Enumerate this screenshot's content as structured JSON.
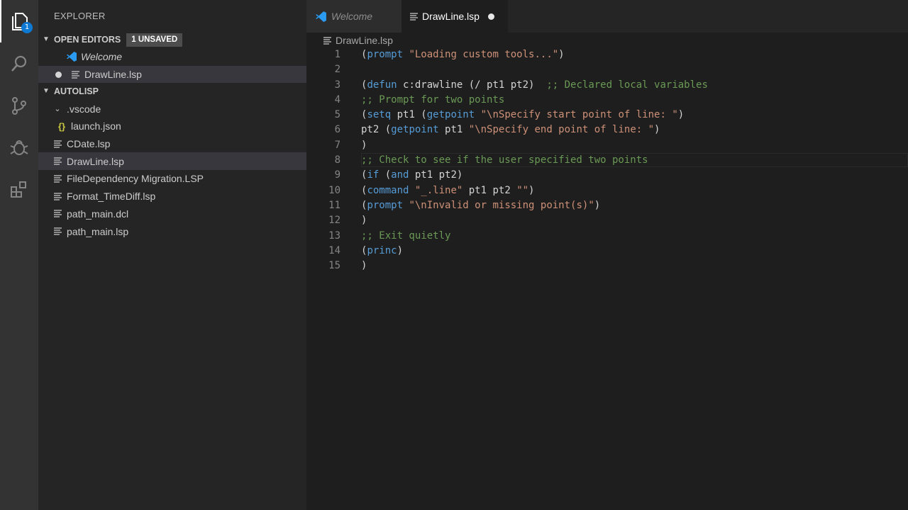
{
  "activity_bar": {
    "items": [
      {
        "name": "explorer",
        "icon": "files-icon",
        "badge": "1",
        "active": true
      },
      {
        "name": "search",
        "icon": "search-icon"
      },
      {
        "name": "scm",
        "icon": "source-control-icon"
      },
      {
        "name": "debug",
        "icon": "debug-icon"
      },
      {
        "name": "extensions",
        "icon": "extensions-icon"
      }
    ]
  },
  "sidebar": {
    "title": "EXPLORER",
    "open_editors": {
      "label": "OPEN EDITORS",
      "badge": "1 UNSAVED",
      "items": [
        {
          "label": "Welcome",
          "icon": "vscode-icon"
        },
        {
          "label": "DrawLine.lsp",
          "icon": "file-lines-icon",
          "modified": true
        }
      ]
    },
    "folder": {
      "label": "AUTOLISP",
      "items": [
        {
          "label": ".vscode",
          "icon": "chevron-down-icon",
          "indent": 1
        },
        {
          "label": "launch.json",
          "icon": "json-icon",
          "indent": 2
        },
        {
          "label": "CDate.lsp",
          "icon": "file-lines-icon",
          "indent": 1
        },
        {
          "label": "DrawLine.lsp",
          "icon": "file-lines-icon",
          "indent": 1,
          "selected": true
        },
        {
          "label": "FileDependency Migration.LSP",
          "icon": "file-lines-icon",
          "indent": 1
        },
        {
          "label": "Format_TimeDiff.lsp",
          "icon": "file-lines-icon",
          "indent": 1
        },
        {
          "label": "path_main.dcl",
          "icon": "file-lines-icon",
          "indent": 1
        },
        {
          "label": "path_main.lsp",
          "icon": "file-lines-icon",
          "indent": 1
        }
      ]
    }
  },
  "tabs": [
    {
      "label": "Welcome",
      "icon": "vscode-icon",
      "active": false
    },
    {
      "label": "DrawLine.lsp",
      "icon": "file-lines-icon",
      "active": true,
      "modified": true
    }
  ],
  "breadcrumb": "DrawLine.lsp",
  "editor": {
    "lines": [
      {
        "n": "1",
        "tokens": [
          [
            "d",
            "("
          ],
          [
            "k",
            "prompt"
          ],
          [
            "d",
            " "
          ],
          [
            "s",
            "\"Loading custom tools...\""
          ],
          [
            "d",
            ")"
          ]
        ]
      },
      {
        "n": "2",
        "tokens": []
      },
      {
        "n": "3",
        "tokens": [
          [
            "d",
            "("
          ],
          [
            "k",
            "defun"
          ],
          [
            "d",
            " c:drawline (/ pt1 pt2)  "
          ],
          [
            "c",
            ";; Declared local variables"
          ]
        ]
      },
      {
        "n": "4",
        "tokens": [
          [
            "c",
            ";; Prompt for two points"
          ]
        ]
      },
      {
        "n": "5",
        "tokens": [
          [
            "d",
            "("
          ],
          [
            "k",
            "setq"
          ],
          [
            "d",
            " pt1 ("
          ],
          [
            "k",
            "getpoint"
          ],
          [
            "d",
            " "
          ],
          [
            "s",
            "\"\\nSpecify start point of line: \""
          ],
          [
            "d",
            ")"
          ]
        ]
      },
      {
        "n": "6",
        "tokens": [
          [
            "d",
            "pt2 ("
          ],
          [
            "k",
            "getpoint"
          ],
          [
            "d",
            " pt1 "
          ],
          [
            "s",
            "\"\\nSpecify end point of line: \""
          ],
          [
            "d",
            ")"
          ]
        ]
      },
      {
        "n": "7",
        "tokens": [
          [
            "d",
            ")"
          ]
        ]
      },
      {
        "n": "8",
        "tokens": [
          [
            "c",
            ";; Check to see if the user specified two points"
          ]
        ],
        "current": true
      },
      {
        "n": "9",
        "tokens": [
          [
            "d",
            "("
          ],
          [
            "k",
            "if"
          ],
          [
            "d",
            " ("
          ],
          [
            "k",
            "and"
          ],
          [
            "d",
            " pt1 pt2)"
          ]
        ]
      },
      {
        "n": "10",
        "tokens": [
          [
            "d",
            "("
          ],
          [
            "k",
            "command"
          ],
          [
            "d",
            " "
          ],
          [
            "s",
            "\"_.line\""
          ],
          [
            "d",
            " pt1 pt2 "
          ],
          [
            "s",
            "\"\""
          ],
          [
            "d",
            ")"
          ]
        ]
      },
      {
        "n": "11",
        "tokens": [
          [
            "d",
            "("
          ],
          [
            "k",
            "prompt"
          ],
          [
            "d",
            " "
          ],
          [
            "s",
            "\"\\nInvalid or missing point(s)\""
          ],
          [
            "d",
            ")"
          ]
        ]
      },
      {
        "n": "12",
        "tokens": [
          [
            "d",
            ")"
          ]
        ]
      },
      {
        "n": "13",
        "tokens": [
          [
            "c",
            ";; Exit quietly"
          ]
        ]
      },
      {
        "n": "14",
        "tokens": [
          [
            "d",
            "("
          ],
          [
            "k",
            "princ"
          ],
          [
            "d",
            ")"
          ]
        ]
      },
      {
        "n": "15",
        "tokens": [
          [
            "d",
            ")"
          ]
        ]
      }
    ]
  }
}
